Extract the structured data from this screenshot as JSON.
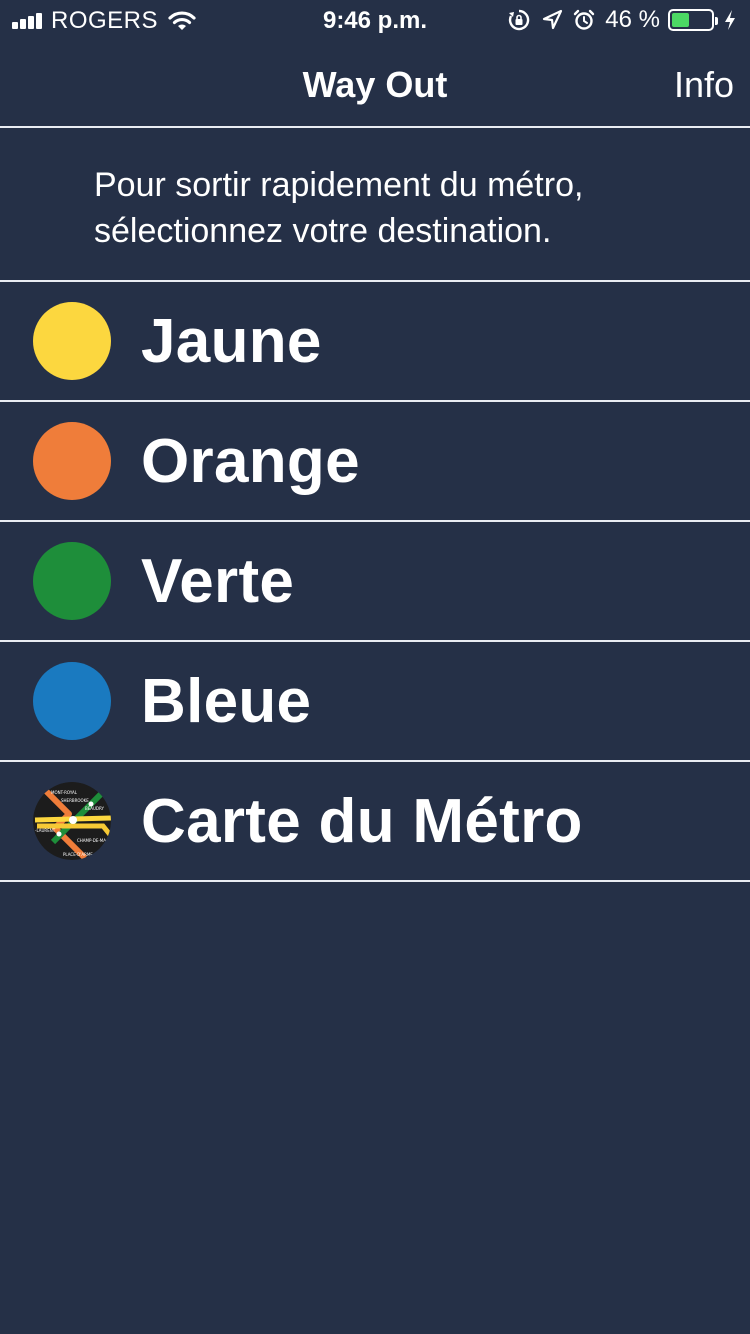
{
  "status_bar": {
    "carrier": "ROGERS",
    "time": "9:46 p.m.",
    "battery_percent": "46 %",
    "battery_level": 0.46,
    "icons": [
      "signal-icon",
      "wifi-icon",
      "orientation-lock-icon",
      "location-icon",
      "alarm-icon",
      "battery-icon",
      "charging-icon"
    ]
  },
  "nav": {
    "title": "Way Out",
    "info_label": "Info"
  },
  "intro": {
    "text": "Pour sortir rapidement du métro, sélectionnez votre destination."
  },
  "lines": [
    {
      "label": "Jaune",
      "color": "#fcd73f"
    },
    {
      "label": "Orange",
      "color": "#ef7d3a"
    },
    {
      "label": "Verte",
      "color": "#1e8e3a"
    },
    {
      "label": "Bleue",
      "color": "#1a7ac0"
    }
  ],
  "map_item": {
    "label": "Carte du Métro",
    "icon": "metro-map-icon",
    "icon_text": [
      "MONT-ROYAL",
      "SHERBROOKE",
      "BEAUDRY",
      "-LAURENT",
      "CHAMP-DE-MA",
      "PLACE-D'ARME"
    ]
  },
  "colors": {
    "background": "#253047",
    "separator": "#e9ecf2",
    "text": "#ffffff",
    "battery_fill": "#4cd964"
  }
}
